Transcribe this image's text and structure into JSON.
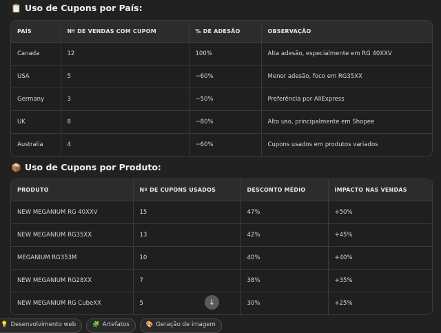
{
  "section1": {
    "icon": "clipboard-icon",
    "title": "Uso de Cupons por País:",
    "headers": [
      "PAÍS",
      "Nº DE VENDAS COM CUPOM",
      "% DE ADESÃO",
      "OBSERVAÇÃO"
    ],
    "rows": [
      [
        "Canada",
        "12",
        "100%",
        "Alta adesão, especialmente em RG 40XXV"
      ],
      [
        "USA",
        "5",
        "~60%",
        "Menor adesão, foco em RG35XX"
      ],
      [
        "Germany",
        "3",
        "~50%",
        "Preferência por AliExpress"
      ],
      [
        "UK",
        "8",
        "~80%",
        "Alto uso, principalmente em Shopee"
      ],
      [
        "Australia",
        "4",
        "~60%",
        "Cupons usados em produtos variados"
      ]
    ]
  },
  "section2": {
    "icon": "package-icon",
    "title": "Uso de Cupons por Produto:",
    "headers": [
      "PRODUTO",
      "Nº DE CUPONS USADOS",
      "DESCONTO MÉDIO",
      "IMPACTO NAS VENDAS"
    ],
    "rows": [
      [
        "NEW MEGANIUM RG 40XXV",
        "15",
        "47%",
        "+50%"
      ],
      [
        "NEW MEGANIUM RG35XX",
        "13",
        "42%",
        "+45%"
      ],
      [
        "MEGANIUM RG353M",
        "10",
        "40%",
        "+40%"
      ],
      [
        "NEW MEGANIUM RG28XX",
        "7",
        "38%",
        "+35%"
      ],
      [
        "NEW MEGANIUM RG CubeXX",
        "5",
        "30%",
        "+25%"
      ]
    ]
  },
  "scroll_button": {
    "icon": "arrow-down-icon"
  },
  "chips": [
    {
      "icon": "lightbulb-icon",
      "label": "Desenvolvimento web"
    },
    {
      "icon": "puzzle-icon",
      "label": "Artefatos"
    },
    {
      "icon": "palette-icon",
      "label": "Geração de imagem"
    }
  ]
}
